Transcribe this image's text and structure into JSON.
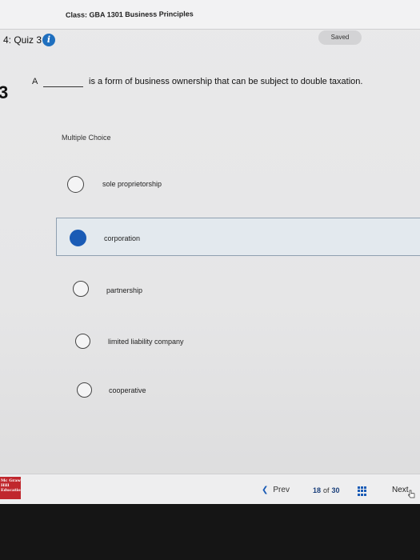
{
  "header": {
    "class_label": "Class: GBA 1301 Business Principles",
    "quiz_title": "4: Quiz 3",
    "info_icon": "info-icon",
    "saved_label": "Saved"
  },
  "question": {
    "number": "3",
    "lead": "A",
    "text": "is a form of business ownership that can be subject to double taxation.",
    "type_label": "Multiple Choice",
    "options": [
      {
        "label": "sole proprietorship",
        "selected": false
      },
      {
        "label": "corporation",
        "selected": true
      },
      {
        "label": "partnership",
        "selected": false
      },
      {
        "label": "limited liability company",
        "selected": false
      },
      {
        "label": "cooperative",
        "selected": false
      }
    ]
  },
  "footer": {
    "logo_text": "Mc Graw Hill Education",
    "prev_label": "Prev",
    "current_page": "18",
    "of_label": "of",
    "total_pages": "30",
    "next_label": "Next"
  },
  "colors": {
    "accent": "#1a5bb5",
    "logo": "#c0272d"
  }
}
